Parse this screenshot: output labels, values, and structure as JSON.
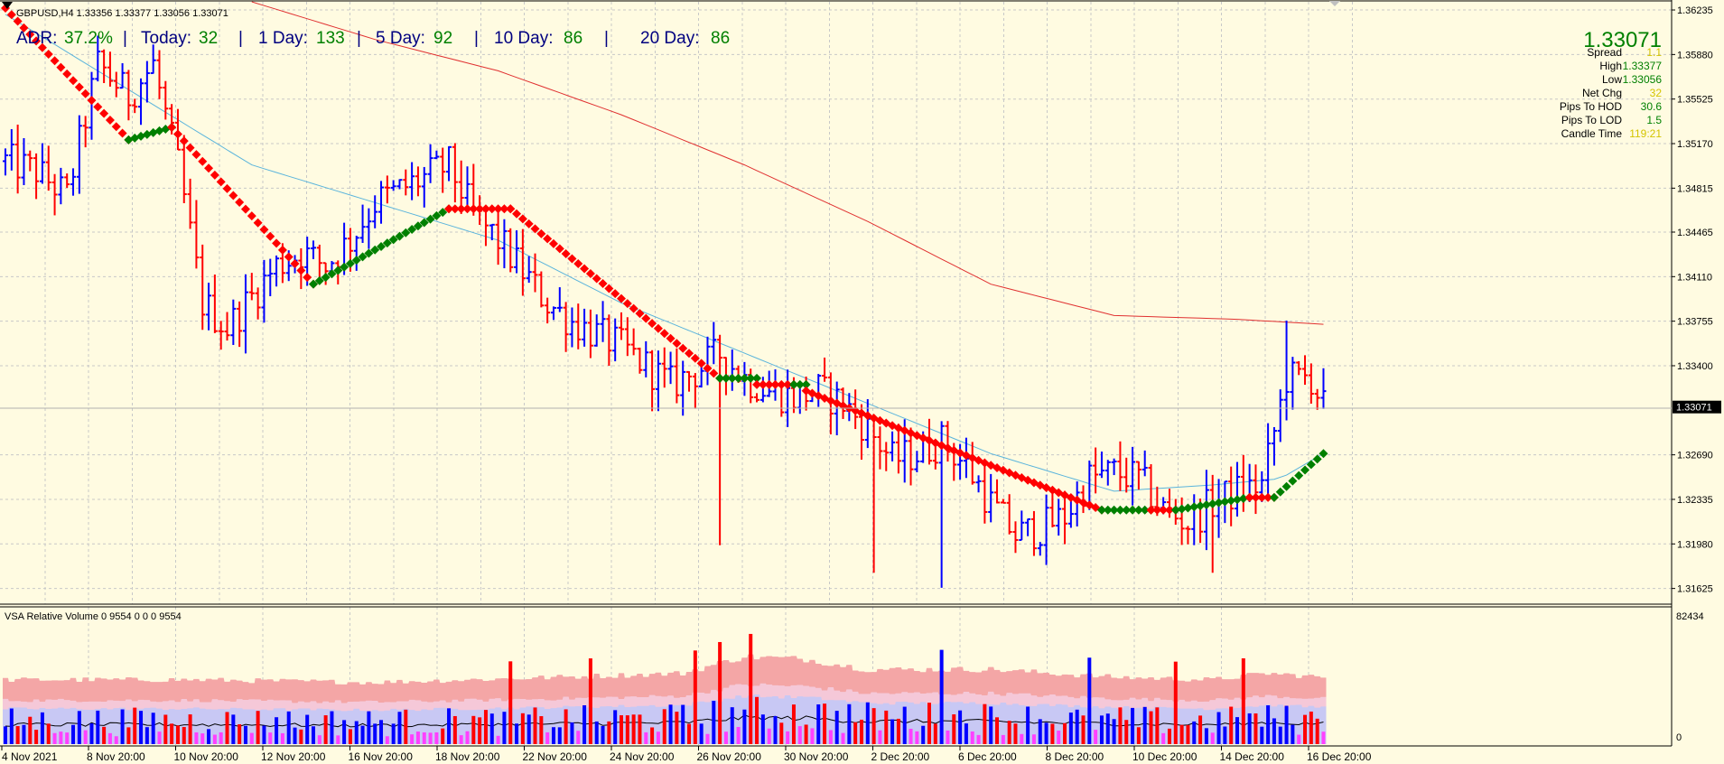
{
  "symbol_header": "GBPUSD,H4  1.33356 1.33377 1.33056 1.33071",
  "adr_bar": {
    "adr_label": "ADR:",
    "adr_value": "37.2%",
    "today_label": "Today:",
    "today_value": "32",
    "d1_label": "1 Day:",
    "d1_value": "133",
    "d5_label": "5 Day:",
    "d5_value": "92",
    "d10_label": "10 Day:",
    "d10_value": "86",
    "d20_label": "20 Day:",
    "d20_value": "86",
    "separator": "|"
  },
  "info_panel": {
    "price": "1.33071",
    "rows": [
      {
        "label": "Spread",
        "value": "1.1",
        "color": "#d4c400"
      },
      {
        "label": "High",
        "value": "1.33377",
        "color": "#008000"
      },
      {
        "label": "Low",
        "value": "1.33056",
        "color": "#008000"
      },
      {
        "label": "Net Chg",
        "value": "32",
        "color": "#d4c400"
      },
      {
        "label": "Pips To HOD",
        "value": "30.6",
        "color": "#008000"
      },
      {
        "label": "Pips To LOD",
        "value": "1.5",
        "color": "#008000"
      },
      {
        "label": "Candle Time",
        "value": "119:21",
        "color": "#d4c400"
      }
    ]
  },
  "volume_header": "VSA Relative Volume 0 9554 0 0 0 9554",
  "volume_axis": {
    "top": "82434",
    "bottom": "0"
  },
  "colors": {
    "background": "#fffbe1",
    "grid": "#c8c8c8",
    "bull_bar": "#0000ff",
    "bear_bar": "#ff0000",
    "ma_fast": "#5ab4dc",
    "ma_slow": "#e03030",
    "trail_down": "#ff0000",
    "trail_up": "#008000",
    "vol_outer": "#f4a6a6",
    "vol_mid": "#f5c8d8",
    "vol_inner": "#c8c8f4",
    "vol_low": "#ff40ff"
  },
  "chart_data": {
    "type": "ohlc",
    "symbol": "GBPUSD",
    "timeframe": "H4",
    "y_ticks": [
      "1.36235",
      "1.35880",
      "1.35525",
      "1.35170",
      "1.34815",
      "1.34465",
      "1.34110",
      "1.33755",
      "1.33400",
      "1.33071",
      "1.32690",
      "1.32335",
      "1.31980",
      "1.31625"
    ],
    "ylim": [
      1.315,
      1.363
    ],
    "current_price": "1.33071",
    "x_labels": [
      "4 Nov 2021",
      "8 Nov 20:00",
      "10 Nov 20:00",
      "12 Nov 20:00",
      "16 Nov 20:00",
      "18 Nov 20:00",
      "22 Nov 20:00",
      "24 Nov 20:00",
      "26 Nov 20:00",
      "30 Nov 20:00",
      "2 Dec 20:00",
      "6 Dec 20:00",
      "8 Dec 20:00",
      "10 Dec 20:00",
      "14 Dec 20:00",
      "16 Dec 20:00"
    ],
    "close_path": [
      [
        0,
        1.3503
      ],
      [
        5,
        1.3495
      ],
      [
        10,
        1.3475
      ],
      [
        15,
        1.358
      ],
      [
        20,
        1.3555
      ],
      [
        24,
        1.358
      ],
      [
        28,
        1.35
      ],
      [
        32,
        1.339
      ],
      [
        36,
        1.337
      ],
      [
        40,
        1.3395
      ],
      [
        44,
        1.342
      ],
      [
        48,
        1.343
      ],
      [
        52,
        1.342
      ],
      [
        56,
        1.344
      ],
      [
        60,
        1.347
      ],
      [
        64,
        1.348
      ],
      [
        68,
        1.349
      ],
      [
        72,
        1.35
      ],
      [
        76,
        1.346
      ],
      [
        80,
        1.344
      ],
      [
        84,
        1.3415
      ],
      [
        88,
        1.339
      ],
      [
        92,
        1.3375
      ],
      [
        96,
        1.3365
      ],
      [
        100,
        1.3355
      ],
      [
        104,
        1.334
      ],
      [
        108,
        1.3325
      ],
      [
        112,
        1.3335
      ],
      [
        116,
        1.335
      ],
      [
        120,
        1.333
      ],
      [
        124,
        1.332
      ],
      [
        128,
        1.3315
      ],
      [
        132,
        1.332
      ],
      [
        136,
        1.331
      ],
      [
        140,
        1.329
      ],
      [
        144,
        1.3265
      ],
      [
        148,
        1.327
      ],
      [
        152,
        1.328
      ],
      [
        156,
        1.326
      ],
      [
        160,
        1.323
      ],
      [
        164,
        1.3205
      ],
      [
        168,
        1.321
      ],
      [
        172,
        1.322
      ],
      [
        176,
        1.325
      ],
      [
        180,
        1.3255
      ],
      [
        184,
        1.325
      ],
      [
        188,
        1.3225
      ],
      [
        192,
        1.3215
      ],
      [
        196,
        1.323
      ],
      [
        200,
        1.324
      ],
      [
        204,
        1.3245
      ],
      [
        208,
        1.333
      ],
      [
        212,
        1.333
      ],
      [
        214,
        1.3307
      ]
    ],
    "ma_fast": [
      [
        0,
        1.362
      ],
      [
        20,
        1.356
      ],
      [
        40,
        1.35
      ],
      [
        60,
        1.347
      ],
      [
        80,
        1.344
      ],
      [
        100,
        1.339
      ],
      [
        120,
        1.335
      ],
      [
        140,
        1.331
      ],
      [
        160,
        1.327
      ],
      [
        180,
        1.324
      ],
      [
        196,
        1.3245
      ],
      [
        207,
        1.325
      ],
      [
        214,
        1.327
      ]
    ],
    "ma_slow": [
      [
        40,
        1.363
      ],
      [
        60,
        1.36
      ],
      [
        80,
        1.3575
      ],
      [
        100,
        1.354
      ],
      [
        120,
        1.35
      ],
      [
        140,
        1.3455
      ],
      [
        160,
        1.3405
      ],
      [
        180,
        1.338
      ],
      [
        200,
        1.3377
      ],
      [
        214,
        1.3373
      ]
    ],
    "trailing_stop": [
      {
        "from": 0,
        "to": 20,
        "start": 1.3625,
        "end": 1.352,
        "dir": "down"
      },
      {
        "from": 20,
        "to": 27,
        "start": 1.352,
        "end": 1.353,
        "dir": "up"
      },
      {
        "from": 27,
        "to": 50,
        "start": 1.353,
        "end": 1.3405,
        "dir": "down"
      },
      {
        "from": 50,
        "to": 72,
        "start": 1.3405,
        "end": 1.3465,
        "dir": "up"
      },
      {
        "from": 72,
        "to": 82,
        "start": 1.3465,
        "end": 1.3465,
        "dir": "down"
      },
      {
        "from": 82,
        "to": 116,
        "start": 1.3465,
        "end": 1.333,
        "dir": "down"
      },
      {
        "from": 116,
        "to": 122,
        "start": 1.333,
        "end": 1.333,
        "dir": "up"
      },
      {
        "from": 122,
        "to": 128,
        "start": 1.3325,
        "end": 1.3325,
        "dir": "down"
      },
      {
        "from": 128,
        "to": 130,
        "start": 1.3325,
        "end": 1.3325,
        "dir": "up"
      },
      {
        "from": 130,
        "to": 178,
        "start": 1.332,
        "end": 1.3225,
        "dir": "down"
      },
      {
        "from": 178,
        "to": 186,
        "start": 1.3225,
        "end": 1.3225,
        "dir": "up"
      },
      {
        "from": 186,
        "to": 190,
        "start": 1.3225,
        "end": 1.3225,
        "dir": "down"
      },
      {
        "from": 190,
        "to": 202,
        "start": 1.3225,
        "end": 1.3235,
        "dir": "up"
      },
      {
        "from": 202,
        "to": 206,
        "start": 1.3235,
        "end": 1.3235,
        "dir": "down"
      },
      {
        "from": 206,
        "to": 214,
        "start": 1.3235,
        "end": 1.327,
        "dir": "up"
      }
    ],
    "volume_ylim": [
      0,
      82434
    ]
  }
}
